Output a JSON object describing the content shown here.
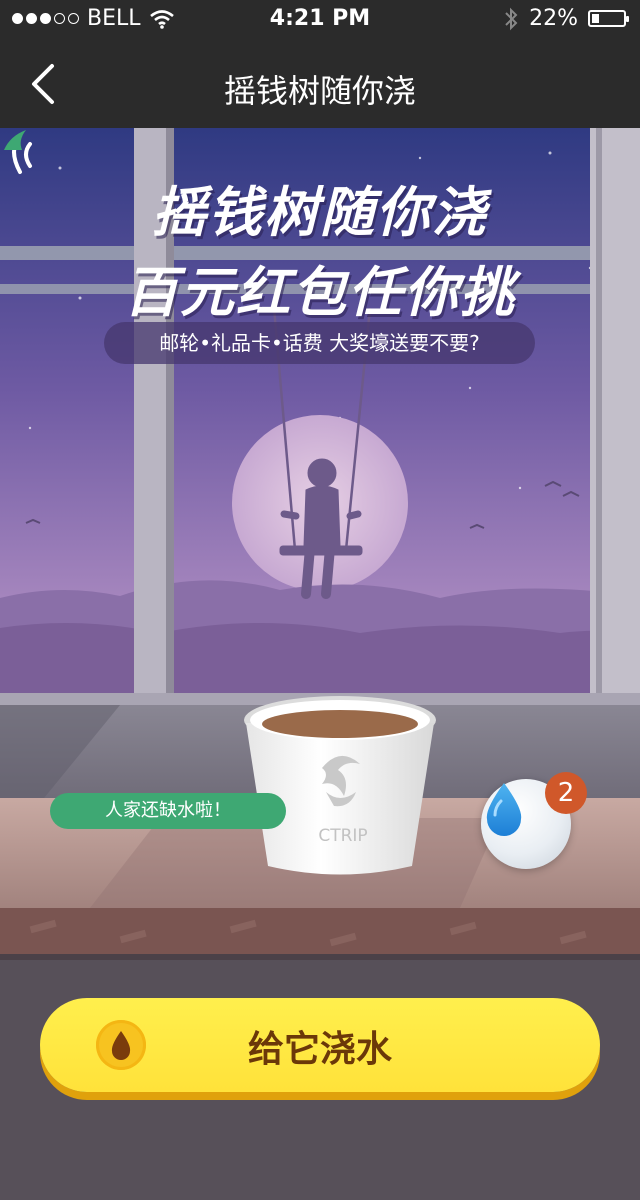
{
  "status_bar": {
    "carrier": "BELL",
    "signal_bars_filled": 3,
    "signal_bars_total": 5,
    "time": "4:21 PM",
    "battery_percent": "22%",
    "battery_level": 0.22
  },
  "nav": {
    "title": "摇钱树随你浇",
    "back_icon": "chevron-left-icon"
  },
  "banner": {
    "title_line1": "摇钱树随你浇",
    "title_line2": "百元红包任你挑",
    "subtitle": "邮轮•礼品卡•话费  大奖壕送要不要?"
  },
  "cup": {
    "brand": "CTRIP",
    "logo_icon": "dolphin-logo-icon"
  },
  "speech_bubble": {
    "text": "人家还缺水啦！"
  },
  "water_drops": {
    "icon": "water-drop-icon",
    "count": "2"
  },
  "action": {
    "label": "给它浇水",
    "icon": "water-drop-icon"
  },
  "colors": {
    "nav_bg": "#2b2b2b",
    "button_yellow": "#ffe23a",
    "button_text": "#6b3809",
    "bubble_green": "#3ea873",
    "badge_orange": "#d0582a"
  }
}
